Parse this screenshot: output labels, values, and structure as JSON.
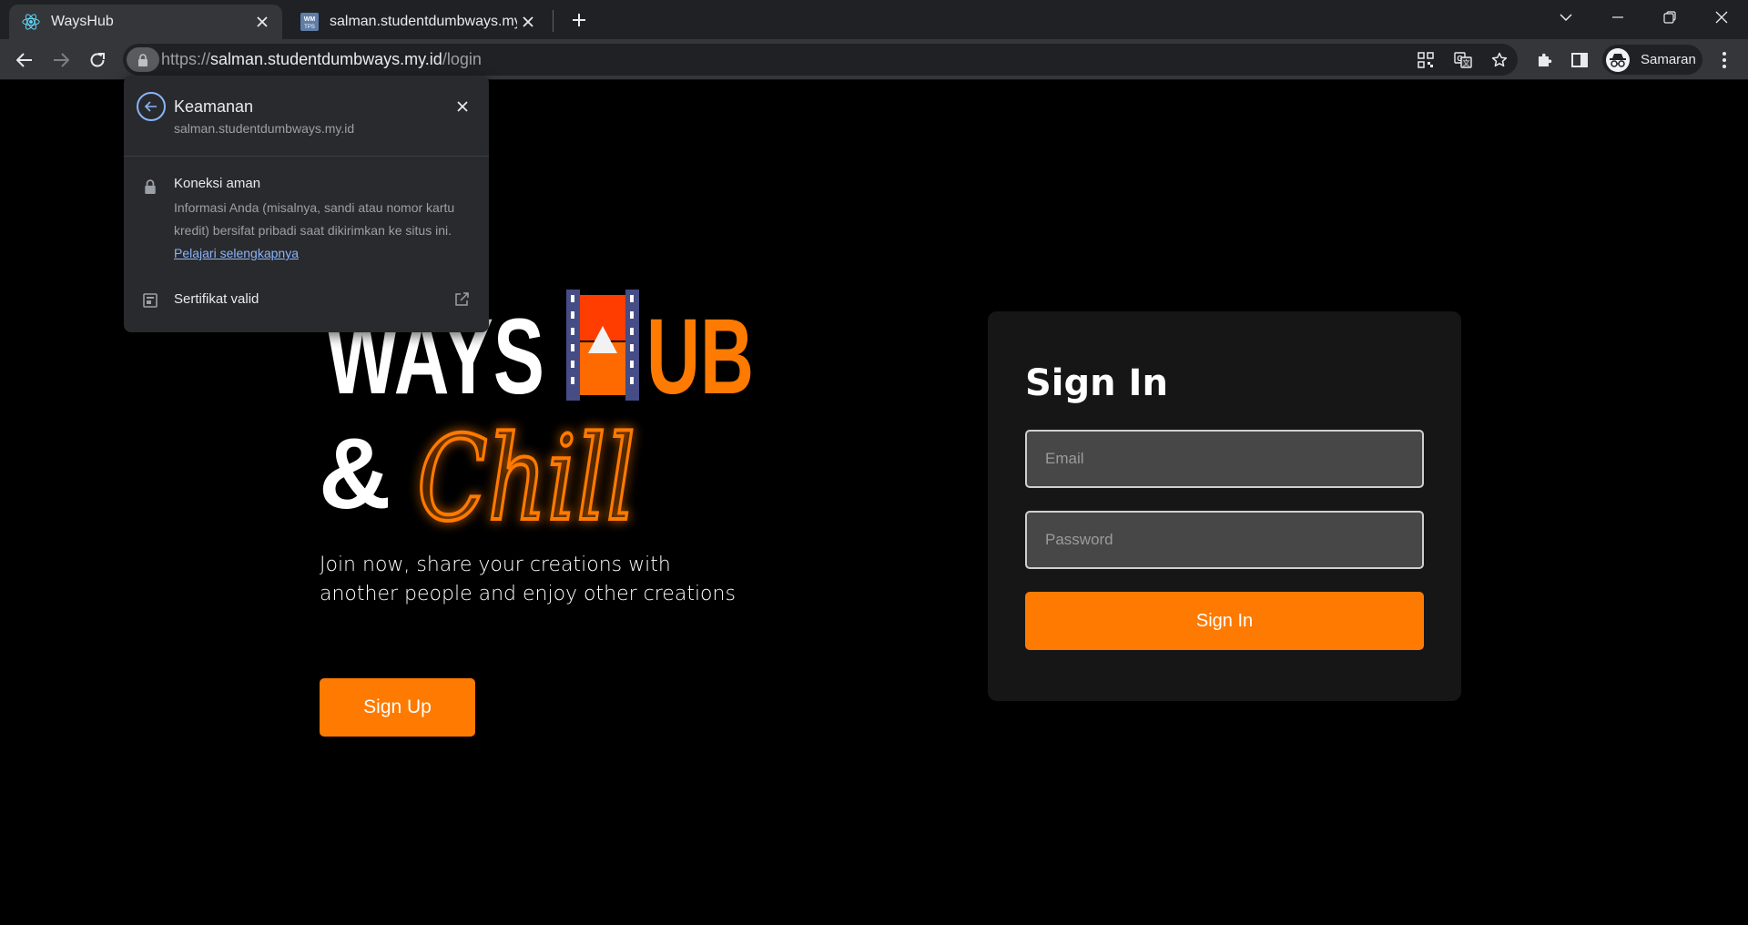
{
  "browser": {
    "tabs": [
      {
        "title": "WaysHub",
        "active": true,
        "favicon": "react-icon"
      },
      {
        "title": "salman.studentdumbways.my.id W",
        "active": false,
        "favicon": "wm-icon",
        "favicon_text": "WM\nTPS"
      }
    ],
    "address": {
      "scheme": "https://",
      "host": "salman.studentdumbways.my.id",
      "path": "/login"
    },
    "profile_name": "Samaran"
  },
  "security_popup": {
    "title": "Keamanan",
    "host": "salman.studentdumbways.my.id",
    "connection_title": "Koneksi aman",
    "connection_desc": "Informasi Anda (misalnya, sandi atau nomor kartu kredit) bersifat pribadi saat dikirimkan ke situs ini.",
    "learn_more": "Pelajari selengkapnya",
    "certificate_label": "Sertifikat valid"
  },
  "page": {
    "logo": {
      "ways": "WAYS",
      "ub": "UB",
      "amp": "&",
      "chill": "Chill"
    },
    "tagline": "Join now, share your creations with another people and enjoy other creations",
    "signup_label": "Sign Up",
    "signin": {
      "heading": "Sign In",
      "email_placeholder": "Email",
      "password_placeholder": "Password",
      "button_label": "Sign In"
    }
  },
  "colors": {
    "accent": "#ff7a00",
    "background": "#000000",
    "card": "#161616",
    "link": "#8ab4f8"
  }
}
